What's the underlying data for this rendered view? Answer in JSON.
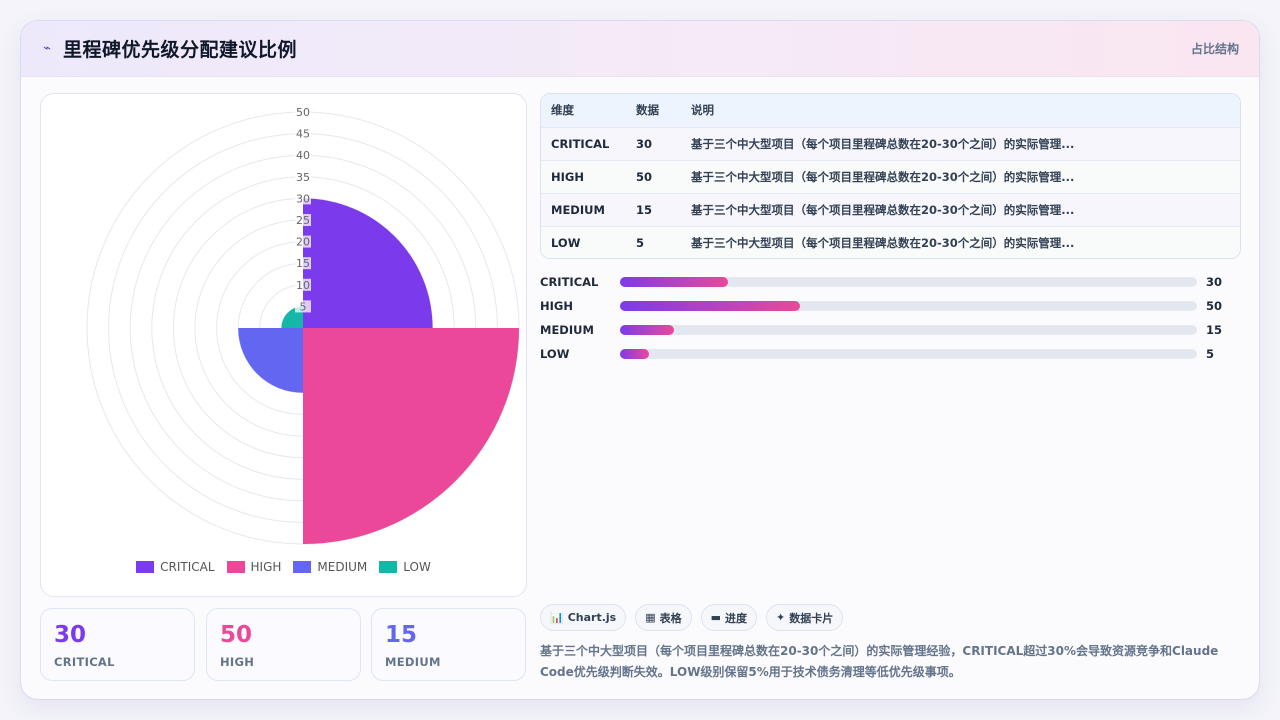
{
  "header": {
    "icon": "trend-icon",
    "title": "里程碑优先级分配建议比例",
    "tag": "占比结构"
  },
  "chart_data": {
    "type": "polarArea",
    "categories": [
      "CRITICAL",
      "HIGH",
      "MEDIUM",
      "LOW"
    ],
    "values": [
      30,
      50,
      15,
      5
    ],
    "colors": [
      "#7c3aed",
      "#ec4899",
      "#6366f1",
      "#14b8a6"
    ],
    "r_ticks": [
      5,
      10,
      15,
      20,
      25,
      30,
      35,
      40,
      45,
      50
    ],
    "r_range": [
      0,
      50
    ],
    "legend_position": "bottom"
  },
  "stats": [
    {
      "value": "30",
      "label": "CRITICAL",
      "color": "#7c3aed"
    },
    {
      "value": "50",
      "label": "HIGH",
      "color": "#ec4899"
    },
    {
      "value": "15",
      "label": "MEDIUM",
      "color": "#6366f1"
    }
  ],
  "table": {
    "headers": [
      "维度",
      "数据",
      "说明"
    ],
    "rows": [
      [
        "CRITICAL",
        "30",
        "基于三个中大型项目（每个项目里程碑总数在20-30个之间）的实际管理..."
      ],
      [
        "HIGH",
        "50",
        "基于三个中大型项目（每个项目里程碑总数在20-30个之间）的实际管理..."
      ],
      [
        "MEDIUM",
        "15",
        "基于三个中大型项目（每个项目里程碑总数在20-30个之间）的实际管理..."
      ],
      [
        "LOW",
        "5",
        "基于三个中大型项目（每个项目里程碑总数在20-30个之间）的实际管理..."
      ]
    ]
  },
  "bars": [
    {
      "label": "CRITICAL",
      "value": "30",
      "fraction": 0.1875
    },
    {
      "label": "HIGH",
      "value": "50",
      "fraction": 0.3125
    },
    {
      "label": "MEDIUM",
      "value": "15",
      "fraction": 0.094
    },
    {
      "label": "LOW",
      "value": "5",
      "fraction": 0.05
    }
  ],
  "chips": [
    {
      "icon": "📊",
      "label": "Chart.js"
    },
    {
      "icon": "▦",
      "label": "表格"
    },
    {
      "icon": "▬",
      "label": "进度"
    },
    {
      "icon": "✦",
      "label": "数据卡片"
    }
  ],
  "note": "基于三个中大型项目（每个项目里程碑总数在20-30个之间）的实际管理经验，CRITICAL超过30%会导致资源竞争和Claude Code优先级判断失效。LOW级别保留5%用于技术债务清理等低优先级事项。"
}
